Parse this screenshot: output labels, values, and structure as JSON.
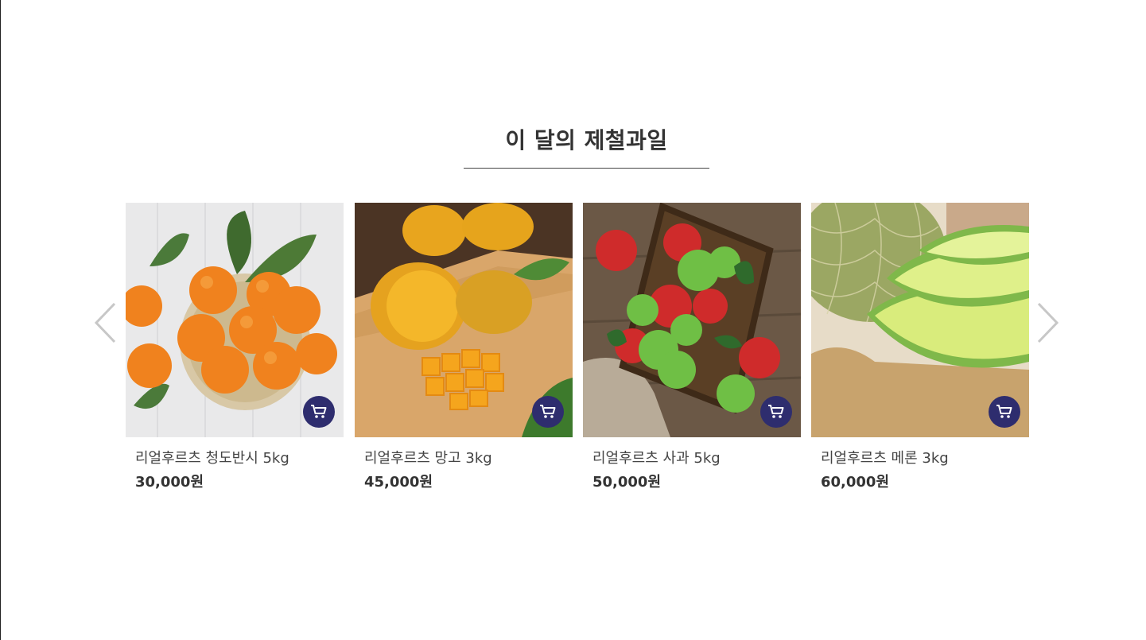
{
  "section": {
    "title": "이 달의 제철과일"
  },
  "products": [
    {
      "name": "리얼후르츠 청도반시 5kg",
      "price": "30,000원"
    },
    {
      "name": "리얼후르츠 망고 3kg",
      "price": "45,000원"
    },
    {
      "name": "리얼후르츠 사과 5kg",
      "price": "50,000원"
    },
    {
      "name": "리얼후르츠 메론 3kg",
      "price": "60,000원"
    }
  ],
  "colors": {
    "cart_button": "#2e2d6e",
    "arrow": "#c7c7c7",
    "text": "#333333"
  },
  "icons": {
    "prev": "chevron-left-icon",
    "next": "chevron-right-icon",
    "cart": "cart-icon"
  }
}
